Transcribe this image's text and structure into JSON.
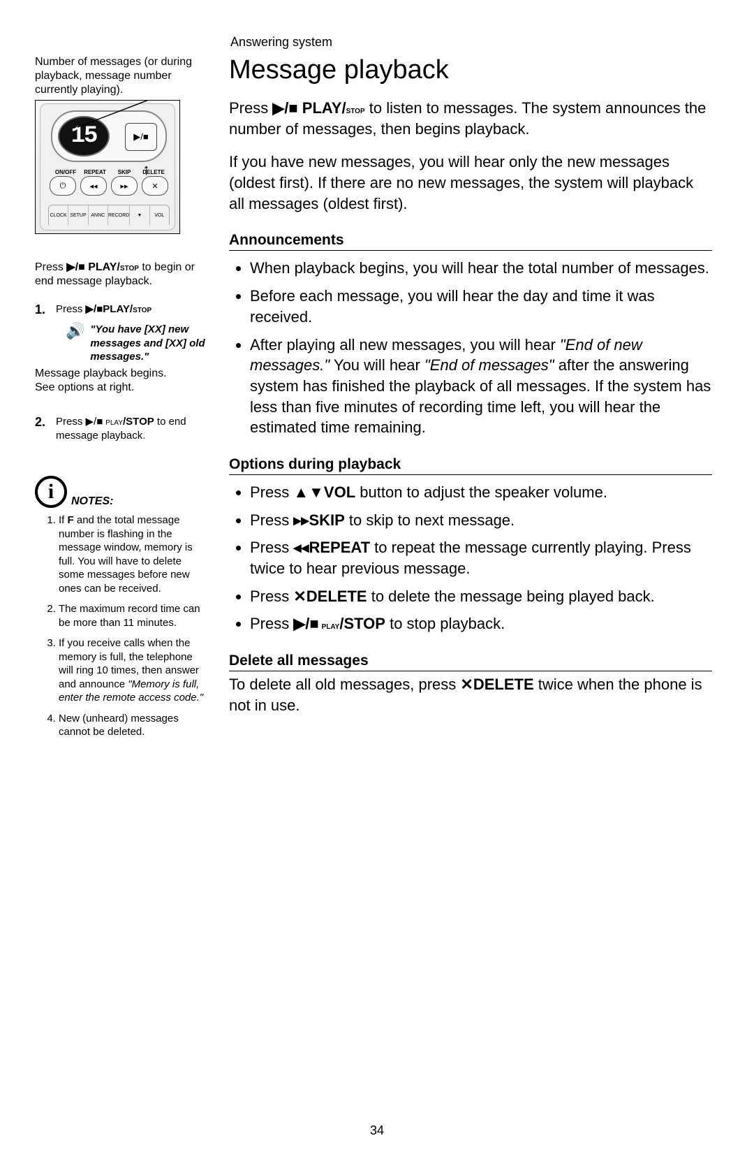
{
  "header": "Answering system",
  "page_number": "34",
  "title": "Message playback",
  "icons": {
    "play_stop": "▶/■",
    "play_stop_small": "▶/■",
    "skip_fwd": "▸▸",
    "repeat": "◂◂",
    "delete_x": "✕",
    "vol": "▲▼",
    "speaker": "🔊",
    "info": "i",
    "up_arrow": "↑"
  },
  "left": {
    "caption": "Number of messages (or during playback, message number currently playing).",
    "display_value": "15",
    "btn_labels": {
      "onoff": "ON/OFF",
      "repeat": "REPEAT",
      "skip": "SKIP",
      "delete": "DELETE",
      "clock": "CLOCK",
      "setup": "SETUP",
      "annc": "ANNC",
      "record": "RECORD",
      "vol": "VOL"
    },
    "btn_glyph": {
      "power": "⏻",
      "rew": "◂◂",
      "fwd": "▸▸",
      "x": "✕",
      "down": "▼"
    },
    "press_intro_1": "Press ",
    "press_intro_2": " PLAY/",
    "press_intro_3": "stop",
    "press_intro_4": " to begin or end message playback.",
    "step1_num": "1.",
    "step1_a": "Press ",
    "step1_b": "PLAY/",
    "step1_c": "stop",
    "quote": "\"You have [XX] new messages and [XX] old messages.\"",
    "after_quote": "Message playback begins.\nSee options at right.",
    "step2_num": "2.",
    "step2_a": "Press ",
    "step2_b": " play",
    "step2_c": "/STOP",
    "step2_d": " to end message playback.",
    "notes_label": "NOTES:",
    "notes": [
      {
        "pre": "If ",
        "bold": "F",
        "post": " and the total message number is flashing in the message window, memory is full. You will have to delete some messages before new ones can be received."
      },
      {
        "text": "The maximum record time can be more than 11 minutes."
      },
      {
        "pre": "If you receive calls when the memory is full, the telephone will ring 10 times, then answer and announce ",
        "ital": "\"Memory is full, enter the remote access code.\""
      },
      {
        "text": "New (unheard) messages cannot be deleted."
      }
    ]
  },
  "right": {
    "p1_a": "Press ",
    "p1_b": " PLAY/",
    "p1_c": "stop",
    "p1_d": " to listen to messages. The system announces the number of messages, then begins playback.",
    "p2": "If you have new messages, you will hear only the new messages (oldest first). If there are no new messages, the system will playback all messages (oldest first).",
    "sec_ann": "Announcements",
    "ann": [
      "When playback begins, you will hear the total number of messages.",
      "Before each message, you will hear the day and time it was received."
    ],
    "ann3_a": "After playing all new messages, you will hear ",
    "ann3_q1": "\"End of new messages.\"",
    "ann3_b": " You will hear ",
    "ann3_q2": "\"End of messages\"",
    "ann3_c": " after the answering system has finished the playback of all messages. If the system has less than five minutes of recording time left, you will hear the estimated time remaining.",
    "sec_opt": "Options during playback",
    "opt1_a": "Press ",
    "opt1_b": "VOL",
    "opt1_c": " button to adjust the speaker volume.",
    "opt2_a": "Press ",
    "opt2_b": "SKIP",
    "opt2_c": " to skip to next message.",
    "opt3_a": "Press ",
    "opt3_b": "REPEAT",
    "opt3_c": " to repeat the message currently playing. Press twice to hear previous message.",
    "opt4_a": "Press ",
    "opt4_b": "DELETE",
    "opt4_c": " to delete the message being played back.",
    "opt5_a": "Press ",
    "opt5_b": " play",
    "opt5_c": "/STOP",
    "opt5_d": " to stop playback.",
    "sec_del": "Delete all messages",
    "del_a": "To delete all old messages, press ",
    "del_b": "DELETE",
    "del_c": " twice when the phone is not in use."
  }
}
